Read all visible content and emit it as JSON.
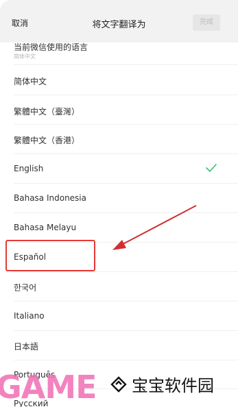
{
  "header": {
    "cancel_label": "取消",
    "title": "将文字翻译为",
    "done_label": "完成"
  },
  "languages": [
    {
      "label": "当前微信使用的语言",
      "sub": "简体中文"
    },
    {
      "label": "简体中文"
    },
    {
      "label": "繁體中文（臺灣）"
    },
    {
      "label": "繁體中文（香港）"
    },
    {
      "label": "English",
      "selected": true
    },
    {
      "label": "Bahasa Indonesia"
    },
    {
      "label": "Bahasa Melayu"
    },
    {
      "label": "Español",
      "highlighted": true
    },
    {
      "label": "한국어"
    },
    {
      "label": "Italiano"
    },
    {
      "label": "日本語"
    },
    {
      "label": "Português"
    },
    {
      "label": "Русский"
    }
  ],
  "annotation": {
    "box_color": "#e53935",
    "arrow_color": "#d32f2f"
  },
  "watermark": {
    "game_text": "GAME",
    "site_name": "宝宝软件园",
    "logo_icon": "diamond-logo-icon"
  },
  "colors": {
    "selected_check": "#3cbf6b",
    "header_bg": "#f2f2f2"
  }
}
